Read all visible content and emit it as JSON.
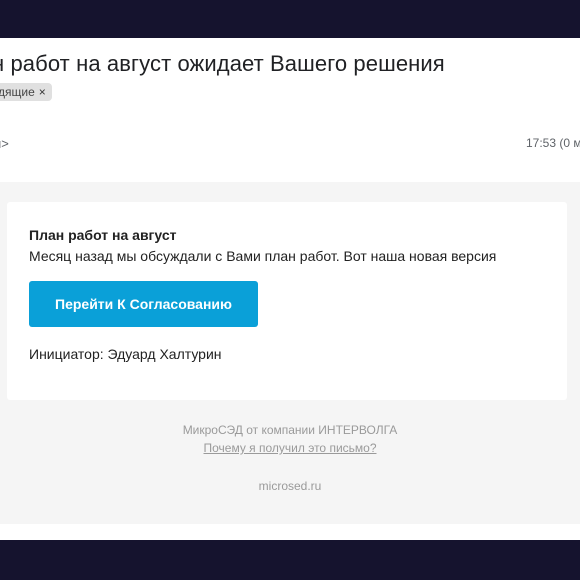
{
  "email": {
    "subject": "н работ на август ожидает Вашего решения",
    "label_chip": "дящие",
    "label_remove": "×",
    "sender_fragment": "u>",
    "time": "17:53 (0 м"
  },
  "card": {
    "title": "План работ на август",
    "text": "Месяц назад мы обсуждали с Вами план работ. Вот наша новая версия",
    "button_label": "Перейти К Согласованию",
    "initiator": "Инициатор: Эдуард Халтурин"
  },
  "footer": {
    "company": "МикроСЭД от компании ИНТЕРВОЛГА",
    "why_link": "Почему я получил это письмо?",
    "domain": "microsed.ru"
  },
  "colors": {
    "frame": "#15132e",
    "button": "#0aa0d8",
    "body_bg": "#f5f5f5"
  }
}
